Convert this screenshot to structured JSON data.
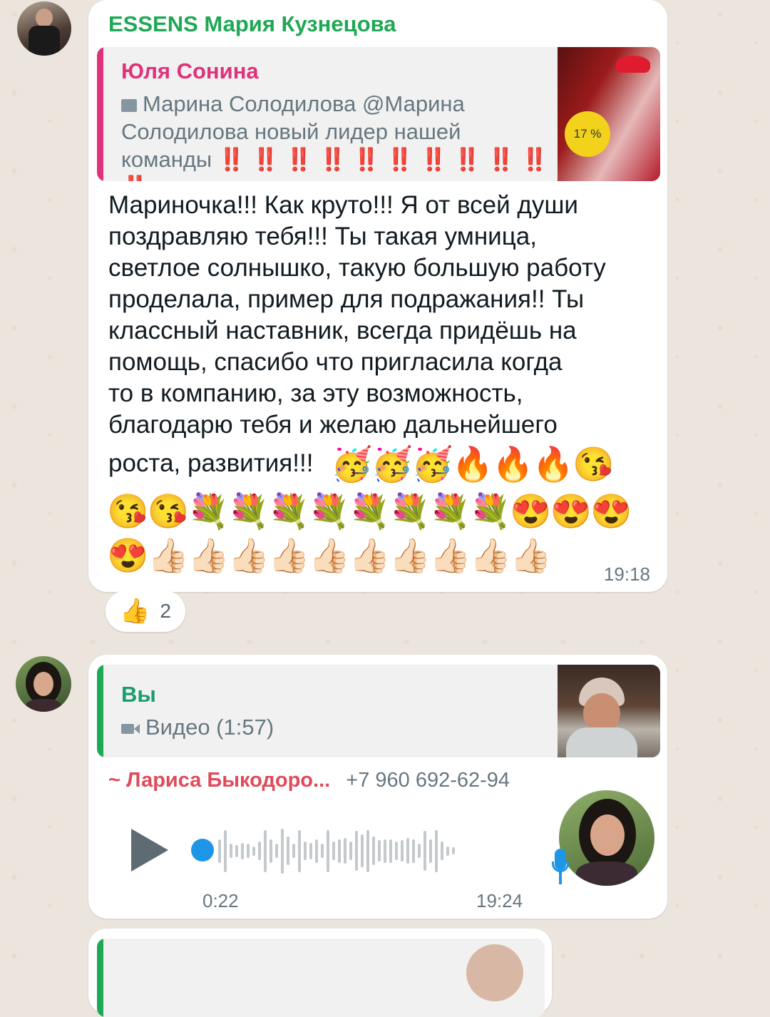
{
  "message1": {
    "sender": "ESSENS Мария Кузнецова",
    "sender_color": "#1fa855",
    "quote": {
      "name": "Юля Сонина",
      "name_color": "#e0327a",
      "bar_color": "#e0327a",
      "media_icon": "image-icon",
      "text": "Марина Солодилова @Марина Солодилова новый лидер нашей команды ‼️ ‼️ ‼️ ‼️ ‼️ ‼️ ‼️ ‼️ ‼️ ‼️ ‼️ …",
      "thumb_badge": "17 %"
    },
    "text_lines": [
      "Мариночка!!! Как круто!!! Я от всей души",
      "поздравляю тебя!!! Ты такая умница,",
      "светлое солнышко, такую большую работу",
      "проделала, пример для подражания!!  Ты",
      "классный наставник, всегда придёшь на",
      "помощь, спасибо что пригласила когда",
      "то в компанию, за эту возможность,",
      "благодарю тебя и желаю дальнейшего"
    ],
    "last_line_text": "роста, развития!!!",
    "emoji_line1": "🥳🥳🥳🔥🔥🔥😘",
    "emoji_line2": "😘😘💐💐💐💐💐💐💐💐😍😍😍",
    "emoji_line3": "😍👍🏻👍🏻👍🏻👍🏻👍🏻👍🏻👍🏻👍🏻👍🏻👍🏻",
    "time": "19:18",
    "reaction": {
      "emoji": "👍",
      "count": "2"
    }
  },
  "message2": {
    "quote": {
      "name": "Вы",
      "name_color": "#1a9e6e",
      "bar_color": "#1fa855",
      "media_icon": "video-icon",
      "text": "Видео (1:57)"
    },
    "forward_author": "~ Лариса Быкодоро...",
    "forward_author_color": "#e04a5a",
    "phone": "+7 960 692-62-94",
    "voice": {
      "duration": "0:22",
      "time": "19:24",
      "accent": "#1e96e8",
      "mic_icon": "microphone-icon",
      "levels": [
        0.5,
        0.9,
        0.3,
        0.25,
        0.35,
        0.3,
        0.2,
        0.4,
        0.9,
        0.5,
        0.3,
        0.95,
        0.6,
        0.3,
        0.9,
        0.4,
        0.35,
        0.5,
        0.3,
        0.9,
        0.4,
        0.5,
        0.55,
        0.4,
        0.85,
        0.7,
        0.9,
        0.6,
        0.45,
        0.5,
        0.5,
        0.4,
        0.45,
        0.55,
        0.5,
        0.3,
        0.85,
        0.5,
        0.9,
        0.4,
        0.2,
        0.15
      ]
    }
  }
}
